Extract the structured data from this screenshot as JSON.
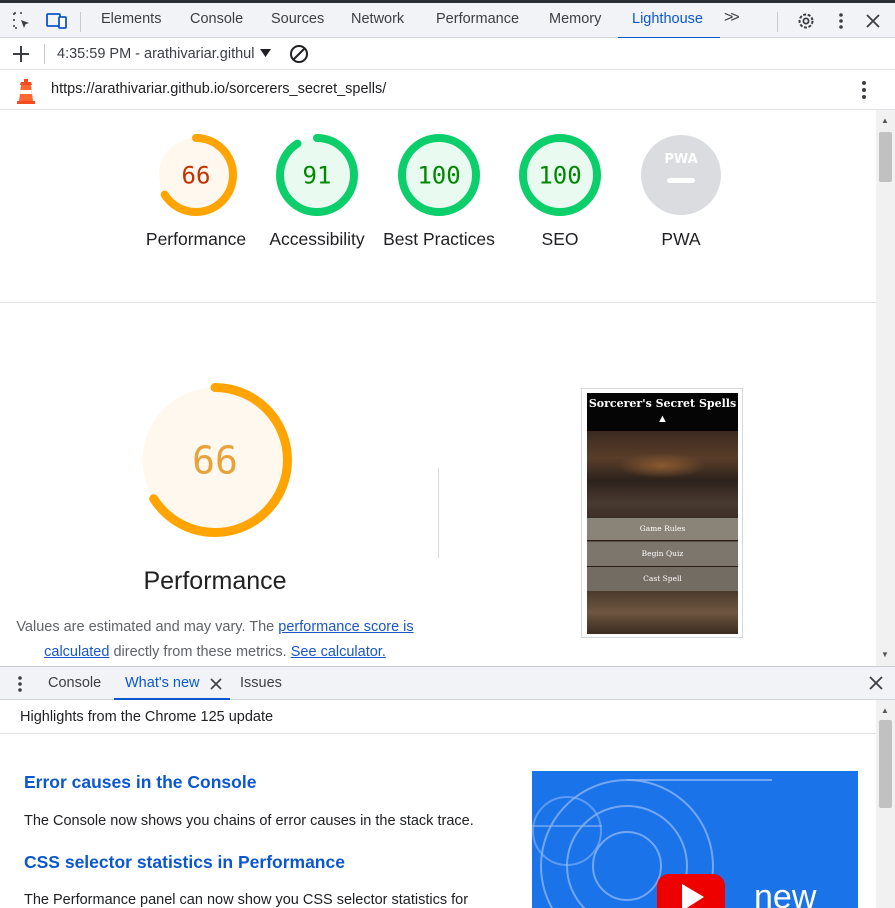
{
  "devtools": {
    "tabs": [
      "Elements",
      "Console",
      "Sources",
      "Network",
      "Performance",
      "Memory",
      "Lighthouse"
    ],
    "active_tab": "Lighthouse",
    "more_tabs_symbol": ">>"
  },
  "toolbar": {
    "report_selector": "4:35:59 PM - arathivariar.githul"
  },
  "url": "https://arathivariar.github.io/sorcerers_secret_spells/",
  "scores": [
    {
      "value": "66",
      "label": "Performance",
      "score": 66,
      "color": "#ffa400",
      "text_color": "#c33300",
      "fill": "#fff8ee"
    },
    {
      "value": "91",
      "label": "Accessibility",
      "score": 91,
      "color": "#0cce6b",
      "text_color": "#008800",
      "fill": "#e9fbf1"
    },
    {
      "value": "100",
      "label": "Best Practices",
      "score": 100,
      "color": "#0cce6b",
      "text_color": "#008800",
      "fill": "#e9fbf1"
    },
    {
      "value": "100",
      "label": "SEO",
      "score": 100,
      "color": "#0cce6b",
      "text_color": "#008800",
      "fill": "#e9fbf1"
    },
    {
      "value": "PWA",
      "label": "PWA",
      "score": null,
      "color": "#dadce0",
      "text_color": "#ffffff",
      "fill": "#dadce0"
    }
  ],
  "main_score": {
    "value": "66",
    "score": 66,
    "title": "Performance",
    "color": "#ffa400",
    "text_color": "#e8a23a"
  },
  "description": {
    "part1": "Values are estimated and may vary. The ",
    "link1": "performance score is calculated",
    "part2": " directly from these metrics. ",
    "link2": "See calculator."
  },
  "screenshot": {
    "title": "Sorcerer's Secret Spells",
    "buttons": [
      "Game Rules",
      "Begin Quiz",
      "Cast Spell"
    ]
  },
  "drawer": {
    "tabs": [
      "Console",
      "What's new",
      "Issues"
    ],
    "active_tab": "What's new",
    "header": "Highlights from the Chrome 125 update",
    "items": [
      {
        "title": "Error causes in the Console",
        "text": "The Console now shows you chains of error causes in the stack trace."
      },
      {
        "title": "CSS selector statistics in Performance",
        "text": "The Performance panel can now show you CSS selector statistics for"
      }
    ],
    "video_text": "new"
  }
}
